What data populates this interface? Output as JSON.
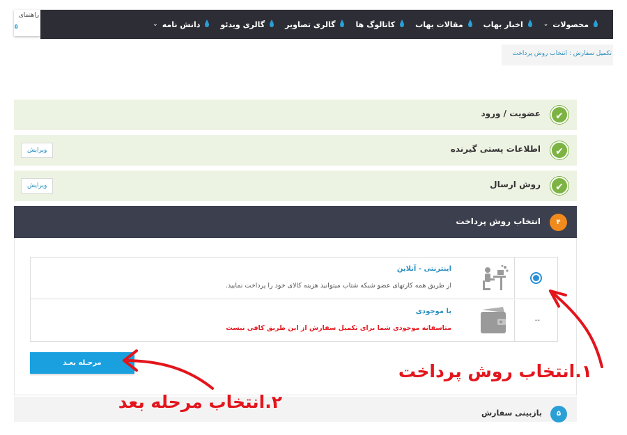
{
  "nav": {
    "items": [
      {
        "label": "محصولات",
        "has_dropdown": true
      },
      {
        "label": "اخبار بهاب",
        "has_dropdown": false
      },
      {
        "label": "مقالات بهاب",
        "has_dropdown": false
      },
      {
        "label": "کاتالوگ ها",
        "has_dropdown": false
      },
      {
        "label": "گالری تصاویر",
        "has_dropdown": false
      },
      {
        "label": "گالری ویدئو",
        "has_dropdown": false
      },
      {
        "label": "دانش نامه",
        "has_dropdown": true
      }
    ],
    "guide_label": "راهنمای",
    "guide_sub": "٥"
  },
  "breadcrumb": "تکمیل سفارش : انتخاب روش پرداخت",
  "steps": {
    "membership": {
      "title": "عضویت / ورود"
    },
    "recipient": {
      "title": "اطلاعات پستی گیرنده",
      "edit_label": "ویرایش"
    },
    "shipping": {
      "title": "روش ارسال",
      "edit_label": "ویرایش"
    },
    "payment": {
      "number": "۴",
      "title": "انتخاب روش پرداخت"
    },
    "review": {
      "number": "۵",
      "title": "بازبینی سفارش"
    }
  },
  "payment_methods": [
    {
      "title": "اینترنتی - آنلاین",
      "description": "از طریق همه کارتهای عضو شبکه شتاب میتوانید هزینه کالای خود را پرداخت نمایید.",
      "selected": true,
      "icon": "online-payment-icon"
    },
    {
      "title": "با موجودی",
      "description": "متاسفانه موجودی شما برای تکمیل سفارش از این طریق کافی نیست",
      "selected": false,
      "unavailable_marker": "--",
      "icon": "wallet-icon"
    }
  ],
  "next_button": "مرحـله بعـد",
  "annotations": {
    "step1": "۱.انتخاب روش پرداخت",
    "step2": "۲.انتخاب مرحله بعد"
  },
  "colors": {
    "nav_bg": "#2d2d35",
    "done_step_bg": "#edf3e3",
    "check_green": "#7cb342",
    "active_step_bg": "#3c3f4d",
    "active_number": "#f08a1c",
    "primary_blue": "#1aa0df",
    "annotation_red": "#e3151c",
    "warning_red": "#e51c23"
  }
}
